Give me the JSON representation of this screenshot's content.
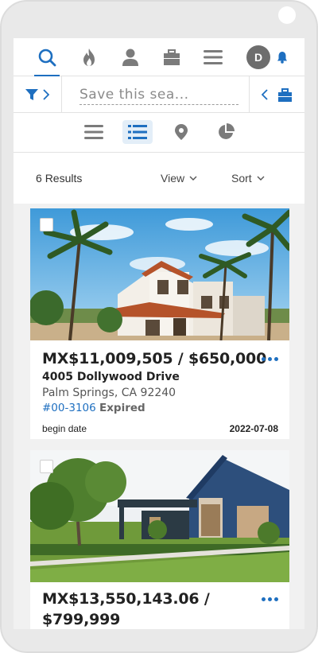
{
  "nav": {
    "avatar_initial": "D",
    "accent_color": "#1e6fc0",
    "icons": [
      "search-icon",
      "flame-icon",
      "person-icon",
      "briefcase-icon",
      "menu-icon",
      "bell-icon"
    ]
  },
  "search": {
    "placeholder": "Save this sea..."
  },
  "view_modes": [
    "list-compact-icon",
    "list-detail-icon",
    "map-pin-icon",
    "pie-chart-icon"
  ],
  "results": {
    "count": "6",
    "count_label": "Results",
    "view_label": "View",
    "sort_label": "Sort"
  },
  "listings": [
    {
      "price": "MX$11,009,505 / $650,000",
      "street": "4005 Dollywood Drive",
      "city": "Palm Springs, CA 92240",
      "mls": "#00-3106",
      "status": "Expired",
      "date_label": "begin date",
      "date_value": "2022-07-08"
    },
    {
      "price_line1": "MX$13,550,143.06 /",
      "price_line2": "$799,999"
    }
  ]
}
